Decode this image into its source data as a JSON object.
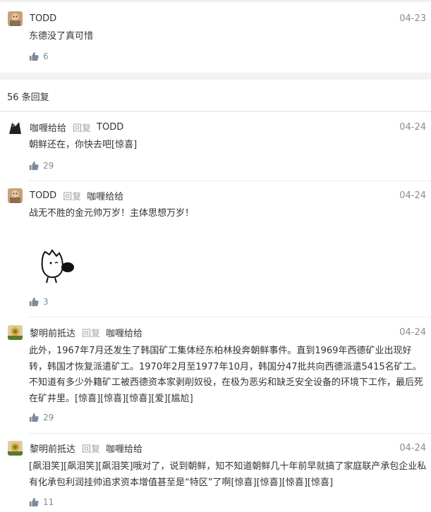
{
  "top_comment": {
    "author": "TODD",
    "date": "04-23",
    "text": "东德没了真可惜",
    "likes": "6"
  },
  "replies_header": "56 条回复",
  "reply_word": "回复",
  "replies": [
    {
      "author": "咖喱给给",
      "reply_to": "TODD",
      "date": "04-24",
      "text": "朝鲜还在，你快去吧[惊喜]",
      "likes": "29"
    },
    {
      "author": "TODD",
      "reply_to": "咖喱给给",
      "date": "04-24",
      "text": "战无不胜的金元帅万岁！主体思想万岁！",
      "likes": "3"
    },
    {
      "author": "黎明前抵达",
      "reply_to": "咖喱给给",
      "date": "04-24",
      "text": "此外，1967年7月还发生了韩国矿工集体经东柏林投奔朝鲜事件。直到1969年西德矿业出现好转，韩国才恢复派遣矿工。1970年2月至1977年10月，韩国分47批共向西德派遣5415名矿工。不知道有多少外籍矿工被西德资本家剥削奴役，在极为恶劣和缺乏安全设备的环境下工作，最后死在矿井里。[惊喜][惊喜][惊喜][爱][尴尬]",
      "likes": "29"
    },
    {
      "author": "黎明前抵达",
      "reply_to": "咖喱给给",
      "date": "04-24",
      "text": "[飙泪笑][飙泪笑][飙泪笑]哦对了，说到朝鲜，知不知道朝鲜几十年前早就搞了家庭联产承包企业私有化承包利润挂帅追求资本增值甚至是“特区”了啊[惊喜][惊喜][惊喜][惊喜]",
      "likes": "11"
    }
  ],
  "icons": {
    "like": "thumbs-up-icon"
  },
  "colors": {
    "divider": "#ebebeb",
    "gap": "#f2f2f2",
    "date": "#8d8d8d",
    "like": "#7d8a9a"
  }
}
